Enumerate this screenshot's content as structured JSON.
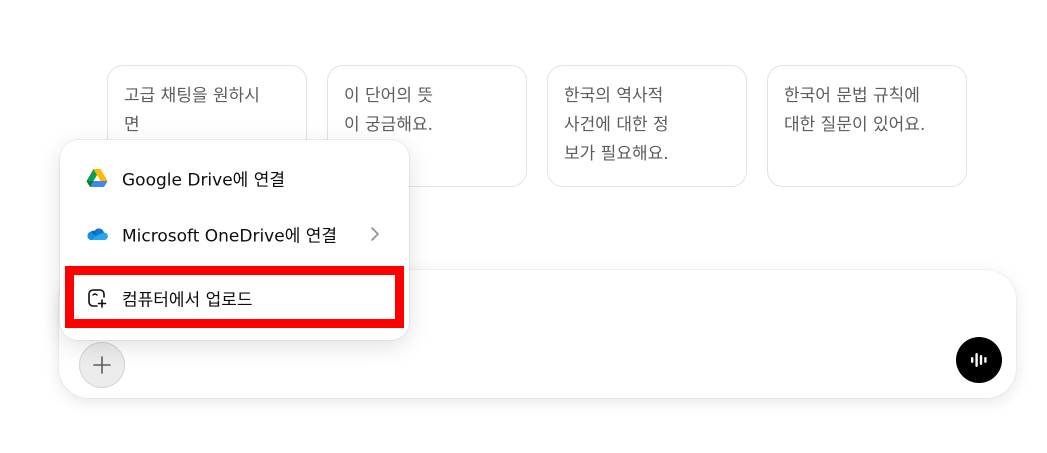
{
  "suggestions": [
    {
      "line1": "고급 채팅을 원하시",
      "line2": "면",
      "line3": ""
    },
    {
      "line1": "이 단어의 뜻",
      "line2": "이 궁금해요.",
      "line3": ""
    },
    {
      "line1": "한국의 역사적",
      "line2": "사건에 대한 정",
      "line3": "보가 필요해요."
    },
    {
      "line1": "한국어 문법 규칙에",
      "line2": "대한 질문이 있어요.",
      "line3": ""
    }
  ],
  "attach_menu": {
    "google_drive_label": "Google Drive에 연결",
    "onedrive_label": "Microsoft OneDrive에 연결",
    "upload_label": "컴퓨터에서 업로드"
  },
  "colors": {
    "highlight": "#ff0000",
    "voice_button": "#000000",
    "plus_button": "#ececec"
  },
  "icons": {
    "google_drive": "google-drive-icon",
    "onedrive": "onedrive-icon",
    "upload": "upload-icon",
    "submenu": "chevron-right-icon",
    "attach": "plus-icon",
    "voice": "voice-waveform-icon"
  }
}
